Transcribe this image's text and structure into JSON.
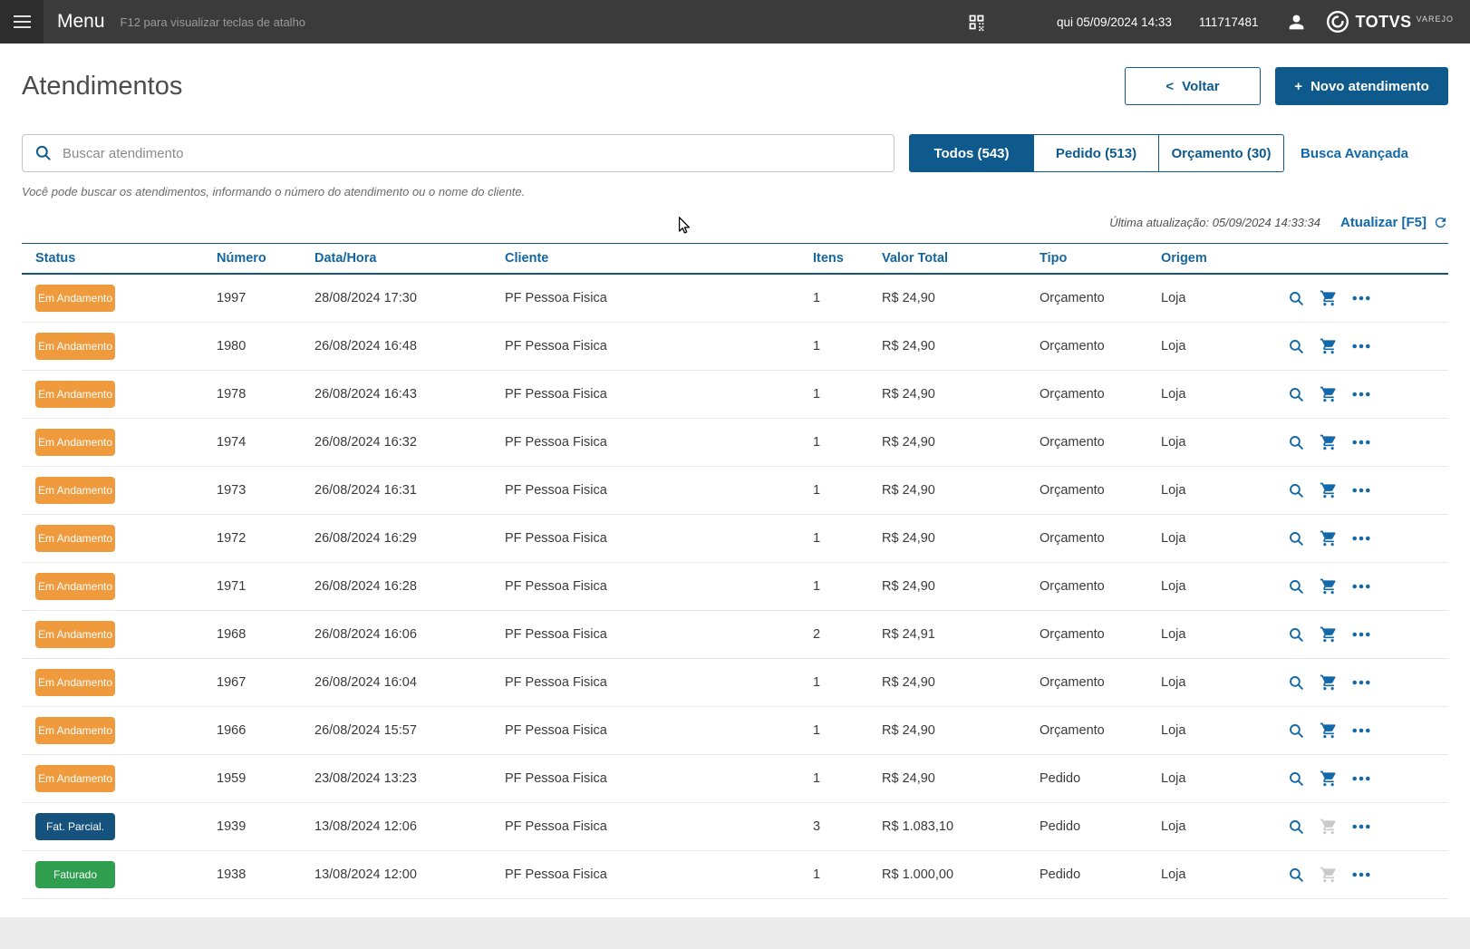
{
  "topbar": {
    "menu_label": "Menu",
    "shortcut_hint": "F12 para visualizar teclas de atalho",
    "datetime": "qui 05/09/2024 14:33",
    "user_id": "111717481",
    "brand": "TOTVS",
    "brand_sub": "VAREJO"
  },
  "header": {
    "title": "Atendimentos",
    "back_icon": "<",
    "back_button": "Voltar",
    "new_icon": "+",
    "new_button": "Novo atendimento"
  },
  "search": {
    "placeholder": "Buscar atendimento",
    "help_text": "Você pode buscar os atendimentos, informando o número do atendimento ou o nome do cliente."
  },
  "tabs": [
    {
      "label": "Todos (543)",
      "active": true
    },
    {
      "label": "Pedido (513)",
      "active": false
    },
    {
      "label": "Orçamento (30)",
      "active": false
    }
  ],
  "advanced_search_label": "Busca Avançada",
  "refresh": {
    "last_update": "Última atualização: 05/09/2024 14:33:34",
    "label": "Atualizar [F5]"
  },
  "table": {
    "columns": [
      "Status",
      "Número",
      "Data/Hora",
      "Cliente",
      "Itens",
      "Valor Total",
      "Tipo",
      "Origem"
    ],
    "rows": [
      {
        "status": "Em Andamento",
        "status_color": "orange",
        "numero": "1997",
        "datahora": "28/08/2024 17:30",
        "cliente": "PF Pessoa Fisica",
        "itens": "1",
        "valor": "R$ 24,90",
        "tipo": "Orçamento",
        "origem": "Loja",
        "cart_enabled": true
      },
      {
        "status": "Em Andamento",
        "status_color": "orange",
        "numero": "1980",
        "datahora": "26/08/2024 16:48",
        "cliente": "PF Pessoa Fisica",
        "itens": "1",
        "valor": "R$ 24,90",
        "tipo": "Orçamento",
        "origem": "Loja",
        "cart_enabled": true
      },
      {
        "status": "Em Andamento",
        "status_color": "orange",
        "numero": "1978",
        "datahora": "26/08/2024 16:43",
        "cliente": "PF Pessoa Fisica",
        "itens": "1",
        "valor": "R$ 24,90",
        "tipo": "Orçamento",
        "origem": "Loja",
        "cart_enabled": true
      },
      {
        "status": "Em Andamento",
        "status_color": "orange",
        "numero": "1974",
        "datahora": "26/08/2024 16:32",
        "cliente": "PF Pessoa Fisica",
        "itens": "1",
        "valor": "R$ 24,90",
        "tipo": "Orçamento",
        "origem": "Loja",
        "cart_enabled": true
      },
      {
        "status": "Em Andamento",
        "status_color": "orange",
        "numero": "1973",
        "datahora": "26/08/2024 16:31",
        "cliente": "PF Pessoa Fisica",
        "itens": "1",
        "valor": "R$ 24,90",
        "tipo": "Orçamento",
        "origem": "Loja",
        "cart_enabled": true
      },
      {
        "status": "Em Andamento",
        "status_color": "orange",
        "numero": "1972",
        "datahora": "26/08/2024 16:29",
        "cliente": "PF Pessoa Fisica",
        "itens": "1",
        "valor": "R$ 24,90",
        "tipo": "Orçamento",
        "origem": "Loja",
        "cart_enabled": true
      },
      {
        "status": "Em Andamento",
        "status_color": "orange",
        "numero": "1971",
        "datahora": "26/08/2024 16:28",
        "cliente": "PF Pessoa Fisica",
        "itens": "1",
        "valor": "R$ 24,90",
        "tipo": "Orçamento",
        "origem": "Loja",
        "cart_enabled": true
      },
      {
        "status": "Em Andamento",
        "status_color": "orange",
        "numero": "1968",
        "datahora": "26/08/2024 16:06",
        "cliente": "PF Pessoa Fisica",
        "itens": "2",
        "valor": "R$ 24,91",
        "tipo": "Orçamento",
        "origem": "Loja",
        "cart_enabled": true
      },
      {
        "status": "Em Andamento",
        "status_color": "orange",
        "numero": "1967",
        "datahora": "26/08/2024 16:04",
        "cliente": "PF Pessoa Fisica",
        "itens": "1",
        "valor": "R$ 24,90",
        "tipo": "Orçamento",
        "origem": "Loja",
        "cart_enabled": true
      },
      {
        "status": "Em Andamento",
        "status_color": "orange",
        "numero": "1966",
        "datahora": "26/08/2024 15:57",
        "cliente": "PF Pessoa Fisica",
        "itens": "1",
        "valor": "R$ 24,90",
        "tipo": "Orçamento",
        "origem": "Loja",
        "cart_enabled": true
      },
      {
        "status": "Em Andamento",
        "status_color": "orange",
        "numero": "1959",
        "datahora": "23/08/2024 13:23",
        "cliente": "PF Pessoa Fisica",
        "itens": "1",
        "valor": "R$ 24,90",
        "tipo": "Pedido",
        "origem": "Loja",
        "cart_enabled": true
      },
      {
        "status": "Fat. Parcial.",
        "status_color": "navy",
        "numero": "1939",
        "datahora": "13/08/2024 12:06",
        "cliente": "PF Pessoa Fisica",
        "itens": "3",
        "valor": "R$ 1.083,10",
        "tipo": "Pedido",
        "origem": "Loja",
        "cart_enabled": false
      },
      {
        "status": "Faturado",
        "status_color": "green",
        "numero": "1938",
        "datahora": "13/08/2024 12:00",
        "cliente": "PF Pessoa Fisica",
        "itens": "1",
        "valor": "R$ 1.000,00",
        "tipo": "Pedido",
        "origem": "Loja",
        "cart_enabled": false
      }
    ]
  },
  "colors": {
    "topbar_bg": "#3B3B3B",
    "primary_blue": "#0F5A8C",
    "link_blue": "#1268A8",
    "table_header_blue": "#1566A0",
    "badge_orange": "#EF9B3D",
    "badge_navy": "#15537E",
    "badge_green": "#2F9E4F"
  }
}
